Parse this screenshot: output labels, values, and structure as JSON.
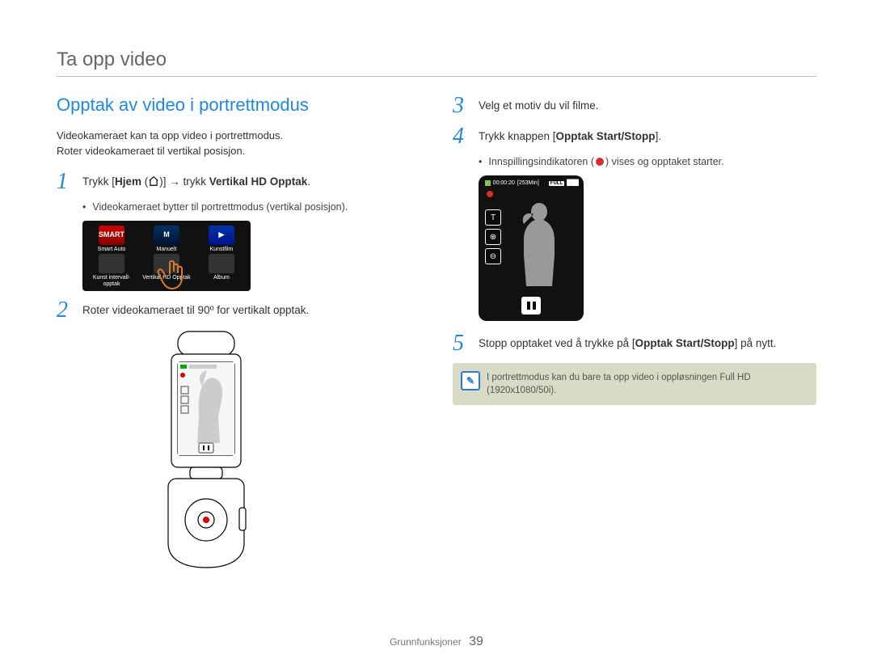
{
  "page_title": "Ta opp video",
  "section_title": "Opptak av video i portrettmodus",
  "intro_line1": "Videokameraet kan ta opp video i portrettmodus.",
  "intro_line2": "Roter videokameraet til vertikal posisjon.",
  "steps": {
    "s1": {
      "num": "1",
      "pre": "Trykk [",
      "b1": "Hjem",
      "mid": " (",
      "post_icon": ")] ",
      "arrow": "→",
      "post": " trykk ",
      "b2": "Vertikal HD Opptak",
      "end": "."
    },
    "s1_bullet": "Videokameraet bytter til portrettmodus (vertikal posisjon).",
    "s2": {
      "num": "2",
      "text": "Roter videokameraet til 90º for vertikalt opptak."
    },
    "s3": {
      "num": "3",
      "text": "Velg et motiv du vil filme."
    },
    "s4": {
      "num": "4",
      "pre": "Trykk knappen [",
      "b1": "Opptak Start/Stopp",
      "post": "]."
    },
    "s4_bullet_pre": "Innspillingsindikatoren (",
    "s4_bullet_post": ") vises og opptaket starter.",
    "s5": {
      "num": "5",
      "pre": "Stopp opptaket ved å trykke på [",
      "b1": "Opptak Start/Stopp",
      "post": "] på nytt."
    }
  },
  "menu": {
    "items": [
      {
        "label": "Smart Auto",
        "badge": "SMART"
      },
      {
        "label": "Manuelt",
        "badge": "M"
      },
      {
        "label": "Kunstfilm",
        "badge": "▶"
      },
      {
        "label": "Kunst intervall-opptak",
        "badge": ""
      },
      {
        "label": "Vertikal HD Opptak",
        "badge": ""
      },
      {
        "label": "Album",
        "badge": ""
      }
    ]
  },
  "portrait_screen": {
    "time": "00:00:20",
    "remaining": "[253Min]",
    "full_badge": "FULL",
    "battery": "███",
    "zoom_t": "T",
    "zoom_in": "⊕",
    "zoom_out": "⊖"
  },
  "note": "I portrettmodus kan du bare ta opp video i oppløsningen Full HD (1920x1080/50i).",
  "footer_section": "Grunnfunksjoner",
  "footer_page": "39"
}
